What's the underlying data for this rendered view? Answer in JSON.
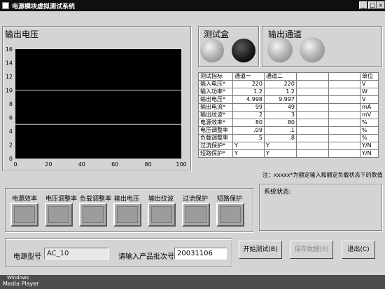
{
  "window": {
    "title": "电源模块虚拟测试系统",
    "controls": {
      "minimize": "_",
      "maximize": "□",
      "close": "×"
    }
  },
  "output_panel": {
    "title": "输出电压"
  },
  "chart_data": {
    "type": "line",
    "title": "",
    "xlabel": "",
    "ylabel": "",
    "xlim": [
      0,
      100
    ],
    "ylim": [
      0,
      16
    ],
    "x_ticks": [
      0,
      20,
      40,
      60,
      80,
      100
    ],
    "y_ticks": [
      0,
      2,
      4,
      6,
      8,
      10,
      12,
      14,
      16
    ],
    "background": "#000000",
    "series": [
      {
        "color": "#c8c8c8",
        "x": [
          0,
          100
        ],
        "y": [
          10,
          10
        ]
      },
      {
        "color": "#c8c8c8",
        "x": [
          0,
          100
        ],
        "y": [
          5,
          5
        ]
      }
    ]
  },
  "test_box": {
    "title": "测试盒",
    "leds": [
      "off",
      "on"
    ]
  },
  "output_channel": {
    "title": "输出通道",
    "leds": [
      "off",
      "off"
    ]
  },
  "table": {
    "headers": [
      "测试指标",
      "通道一",
      "通道二",
      "",
      "",
      "单位"
    ],
    "rows": [
      [
        "输入电压*",
        "220",
        "220",
        "",
        "",
        "V"
      ],
      [
        "输入功率*",
        "1.2",
        "1.2",
        "",
        "",
        "W"
      ],
      [
        "输出电压*",
        "4.998",
        "9.997",
        "",
        "",
        "V"
      ],
      [
        "输出电流*",
        "99",
        "49",
        "",
        "",
        "mA"
      ],
      [
        "输出纹波*",
        "2",
        "3",
        "",
        "",
        "mV"
      ],
      [
        "电源效率*",
        "80",
        "80",
        "",
        "",
        "%"
      ],
      [
        "电压调整率",
        ".09",
        ".1",
        "",
        "",
        "%"
      ],
      [
        "负载调整率",
        ".5",
        ".8",
        "",
        "",
        "%"
      ],
      [
        "过流保护*",
        "Y",
        "Y",
        "",
        "",
        "Y/N"
      ],
      [
        "短路保护*",
        "Y",
        "Y",
        "",
        "",
        "Y/N"
      ]
    ]
  },
  "note": "注：xxxxx*为额定输入和额定负载状态下的数值",
  "status_items": [
    "电源效率",
    "电压调整率",
    "负载调整率",
    "输出电压",
    "输出纹波",
    "过流保护",
    "短路保护"
  ],
  "system_status": {
    "label": "系统状态:"
  },
  "form": {
    "model_label": "电源型号",
    "model_value": "AC_10",
    "batch_label": "请输入产品批次号",
    "batch_value": "20031106"
  },
  "buttons": {
    "start": "开始测试(B)",
    "save": "保存数据(S)",
    "exit": "退出(C)"
  },
  "taskbar": {
    "line1": "Windows",
    "line2": "Media Player"
  }
}
